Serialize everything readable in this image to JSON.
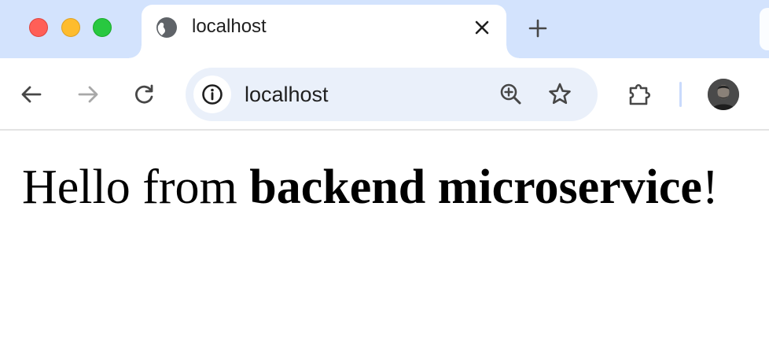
{
  "window": {
    "traffic_lights": {
      "close_color": "#ff5f57",
      "minimize_color": "#febc2e",
      "maximize_color": "#28c840"
    }
  },
  "tab": {
    "title": "localhost",
    "favicon": "globe-icon",
    "close_icon": "close-icon"
  },
  "new_tab": {
    "icon": "plus-icon"
  },
  "toolbar": {
    "back_icon": "arrow-left-icon",
    "forward_icon": "arrow-right-icon",
    "reload_icon": "reload-icon",
    "extensions_icon": "puzzle-icon"
  },
  "omnibox": {
    "site_info_icon": "info-icon",
    "url": "localhost",
    "zoom_icon": "zoom-in-icon",
    "bookmark_icon": "star-icon"
  },
  "page": {
    "heading_prefix": "Hello from ",
    "heading_bold": "backend microservice",
    "heading_suffix": "!"
  },
  "colors": {
    "tabstrip": "#d3e3fd",
    "omnibox": "#eaf0fa",
    "icon": "#474747",
    "icon_disabled": "#a8a8a8"
  }
}
